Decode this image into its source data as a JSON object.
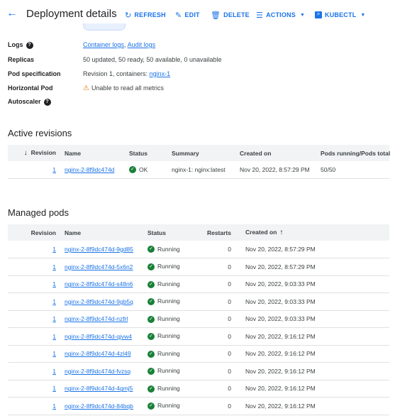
{
  "header": {
    "back_icon": "arrow-left-icon",
    "title": "Deployment details",
    "refresh": "REFRESH",
    "edit": "EDIT",
    "delete": "DELETE",
    "actions": "ACTIONS",
    "kubectl": "KUBECTL"
  },
  "props": {
    "logs_label": "Logs",
    "container_logs": "Container logs",
    "audit_logs": "Audit logs",
    "replicas_label": "Replicas",
    "replicas_value": "50 updated, 50 ready, 50 available, 0 unavailable",
    "podspec_label": "Pod specification",
    "podspec_prefix": "Revision 1, containers:",
    "podspec_link": "nginx-1",
    "hpa_label_1": "Horizontal Pod",
    "hpa_label_2": "Autoscaler",
    "hpa_value": "Unable to read all metrics"
  },
  "active_revisions": {
    "title": "Active revisions",
    "headers": {
      "revision": "Revision",
      "name": "Name",
      "status": "Status",
      "summary": "Summary",
      "created": "Created on",
      "pods": "Pods running/Pods total"
    },
    "rows": [
      {
        "revision": "1",
        "name": "nginx-2-8f9dc474d",
        "status": "OK",
        "summary": "nginx-1: nginx:latest",
        "created": "Nov 20, 2022, 8:57:29 PM",
        "pods": "50/50"
      }
    ]
  },
  "managed_pods": {
    "title": "Managed pods",
    "headers": {
      "revision": "Revision",
      "name": "Name",
      "status": "Status",
      "restarts": "Restarts",
      "created": "Created on"
    },
    "rows": [
      {
        "revision": "1",
        "name": "nginx-2-8f9dc474d-9gd85",
        "status": "Running",
        "restarts": "0",
        "created": "Nov 20, 2022, 8:57:29 PM"
      },
      {
        "revision": "1",
        "name": "nginx-2-8f9dc474d-5x6n2",
        "status": "Running",
        "restarts": "0",
        "created": "Nov 20, 2022, 8:57:29 PM"
      },
      {
        "revision": "1",
        "name": "nginx-2-8f9dc474d-s48n6",
        "status": "Running",
        "restarts": "0",
        "created": "Nov 20, 2022, 9:03:33 PM"
      },
      {
        "revision": "1",
        "name": "nginx-2-8f9dc474d-9gb5q",
        "status": "Running",
        "restarts": "0",
        "created": "Nov 20, 2022, 9:03:33 PM"
      },
      {
        "revision": "1",
        "name": "nginx-2-8f9dc474d-nzfrl",
        "status": "Running",
        "restarts": "0",
        "created": "Nov 20, 2022, 9:03:33 PM"
      },
      {
        "revision": "1",
        "name": "nginx-2-8f9dc474d-qjvw4",
        "status": "Running",
        "restarts": "0",
        "created": "Nov 20, 2022, 9:16:12 PM"
      },
      {
        "revision": "1",
        "name": "nginx-2-8f9dc474d-4zl49",
        "status": "Running",
        "restarts": "0",
        "created": "Nov 20, 2022, 9:16:12 PM"
      },
      {
        "revision": "1",
        "name": "nginx-2-8f9dc474d-fvzsq",
        "status": "Running",
        "restarts": "0",
        "created": "Nov 20, 2022, 9:16:12 PM"
      },
      {
        "revision": "1",
        "name": "nginx-2-8f9dc474d-4gmj5",
        "status": "Running",
        "restarts": "0",
        "created": "Nov 20, 2022, 9:16:12 PM"
      },
      {
        "revision": "1",
        "name": "nginx-2-8f9dc474d-84bqb",
        "status": "Running",
        "restarts": "0",
        "created": "Nov 20, 2022, 9:16:12 PM"
      }
    ]
  },
  "colors": {
    "accent": "#1a73e8",
    "ok": "#188038",
    "warning": "#e37400",
    "header_bg": "#f1f3f4"
  }
}
